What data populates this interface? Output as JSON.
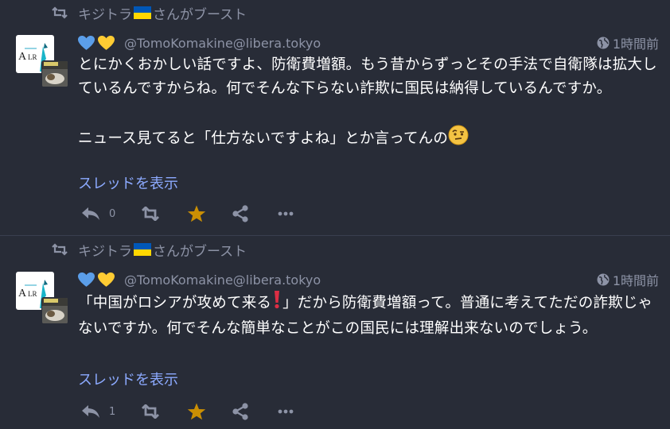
{
  "statuses": [
    {
      "booster": "キジトラ",
      "boost_suffix": "さんがブースト",
      "account": "@TomoKomakine@libera.tokyo",
      "time": "1時間前",
      "paragraphs": [
        "とにかくおかしい話ですよ、防衛費増額。もう昔からずっとその手法で自衛隊は拡大しているんですからね。何でそんな下らない詐欺に国民は納得しているんですか。",
        "ニュース見てると「仕方ないですよね」とか言ってんの"
      ],
      "emoji": "face-with-raised-eyebrow",
      "thread_link": "スレッドを表示",
      "reply_count": "0"
    },
    {
      "booster": "キジトラ",
      "boost_suffix": "さんがブースト",
      "account": "@TomoKomakine@libera.tokyo",
      "time": "1時間前",
      "paragraph_before": "「中国がロシアが攻めて来る",
      "paragraph_after": "」だから防衛費増額って。普通に考えてただの詐欺じゃないですか。何でそんな簡単なことがこの国民には理解出来ないのでしょう。",
      "emoji": "exclamation-mark",
      "thread_link": "スレッドを表示",
      "reply_count": "1"
    }
  ],
  "avatar_text": "A LR",
  "colors": {
    "background": "#282c37",
    "muted": "#8d93a6",
    "link": "#8caaff",
    "star": "#ca8f04",
    "heart_blue": "#5b9ee9",
    "heart_yellow": "#ffcc33"
  }
}
